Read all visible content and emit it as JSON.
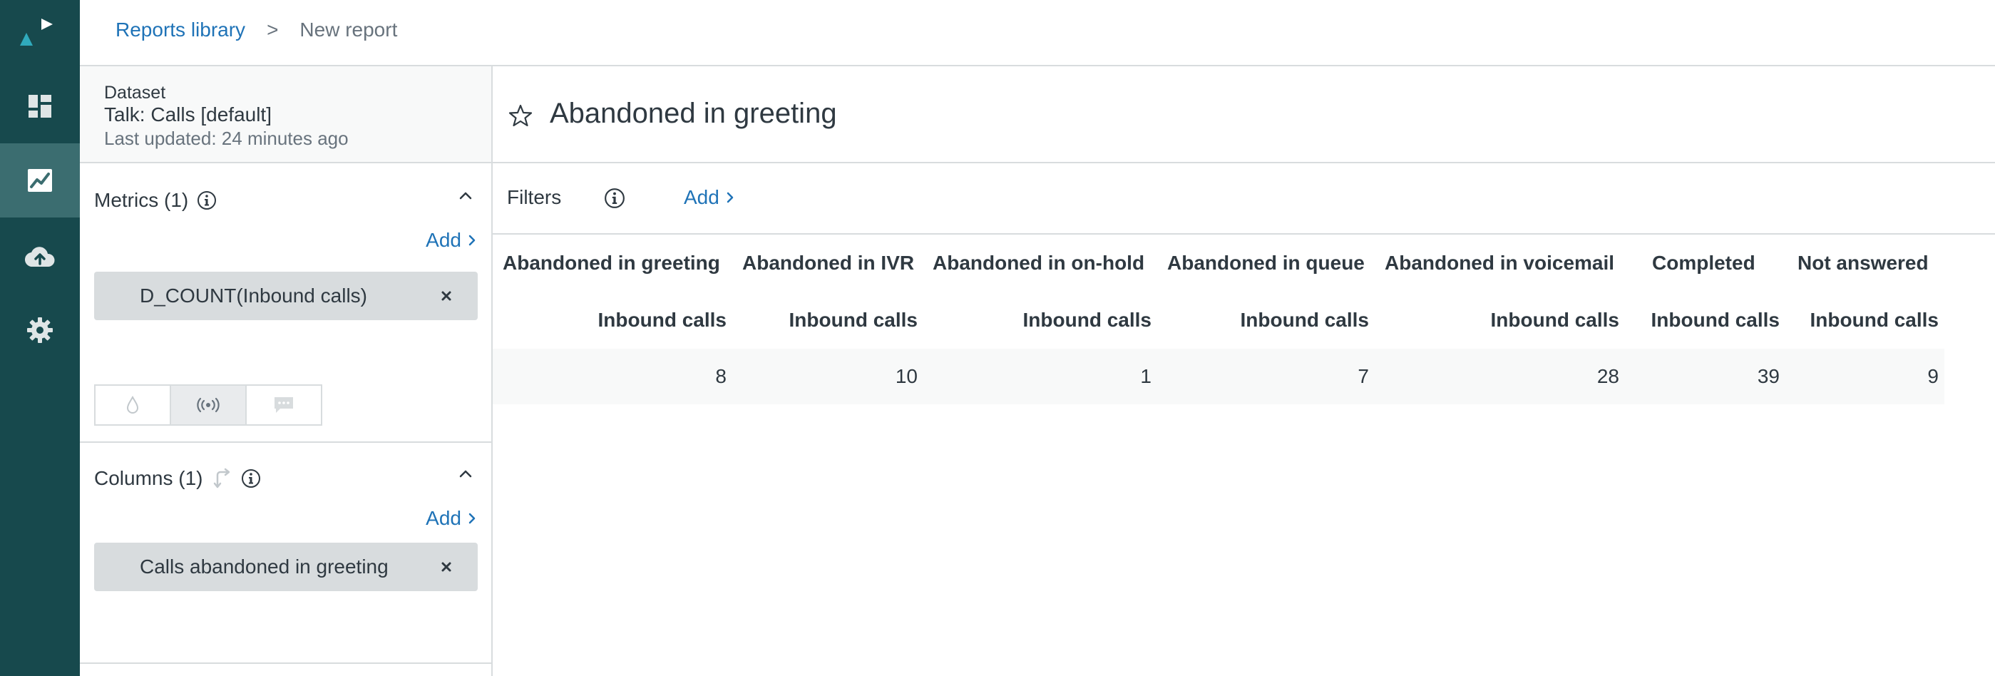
{
  "nav": {
    "items": [
      {
        "icon": "dashboard-icon"
      },
      {
        "icon": "reports-chart-icon",
        "active": true
      },
      {
        "icon": "cloud-upload-icon"
      },
      {
        "icon": "gear-icon"
      }
    ]
  },
  "breadcrumb": {
    "parent": "Reports library",
    "separator": ">",
    "current": "New report"
  },
  "dataset": {
    "label": "Dataset",
    "name": "Talk: Calls [default]",
    "updated": "Last updated: 24 minutes ago"
  },
  "metrics": {
    "title": "Metrics (1)",
    "add_label": "Add",
    "items": [
      "D_COUNT(Inbound calls)"
    ]
  },
  "columns": {
    "title": "Columns (1)",
    "add_label": "Add",
    "items": [
      "Calls abandoned in greeting"
    ]
  },
  "report": {
    "title": "Abandoned in greeting"
  },
  "filters": {
    "label": "Filters",
    "add_label": "Add"
  },
  "table": {
    "columns": [
      {
        "header": "Abandoned in greeting",
        "sub": "Inbound calls",
        "value": "8"
      },
      {
        "header": "Abandoned in IVR",
        "sub": "Inbound calls",
        "value": "10"
      },
      {
        "header": "Abandoned in on-hold",
        "sub": "Inbound calls",
        "value": "1"
      },
      {
        "header": "Abandoned in queue",
        "sub": "Inbound calls",
        "value": "7"
      },
      {
        "header": "Abandoned in voicemail",
        "sub": "Inbound calls",
        "value": "28"
      },
      {
        "header": "Completed",
        "sub": "Inbound calls",
        "value": "39"
      },
      {
        "header": "Not answered",
        "sub": "Inbound calls",
        "value": "9"
      }
    ]
  },
  "colors": {
    "rail": "#17494d",
    "rail_active": "#3b6d70",
    "link": "#1f73b7",
    "pill": "#d8dcde"
  }
}
